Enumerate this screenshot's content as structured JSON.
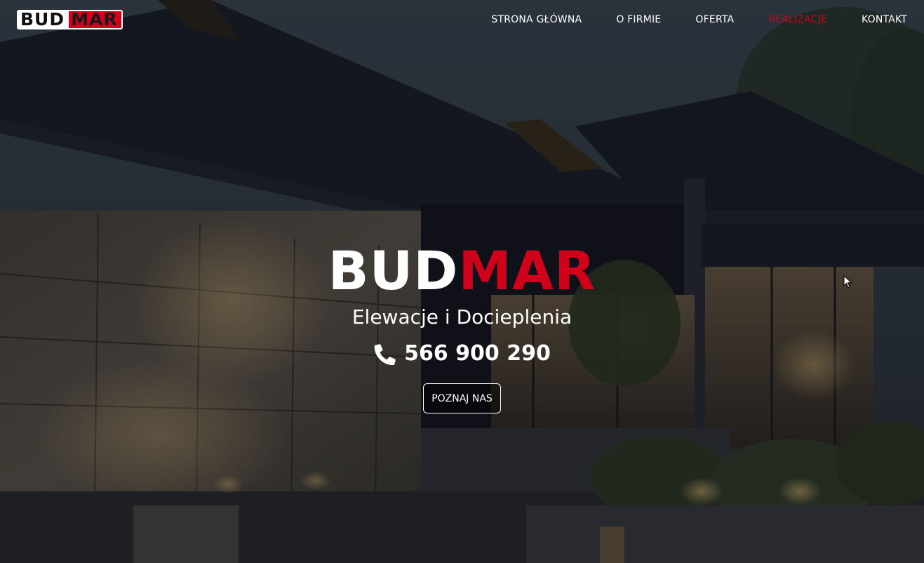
{
  "logo": {
    "part1": "BUD",
    "part2": "MAR"
  },
  "nav": {
    "items": [
      {
        "label": "STRONA GŁÓWNA",
        "active": false
      },
      {
        "label": "O FIRMIE",
        "active": false
      },
      {
        "label": "OFERTA",
        "active": false
      },
      {
        "label": "REALIZACJE",
        "active": true
      },
      {
        "label": "KONTAKT",
        "active": false
      }
    ]
  },
  "hero": {
    "brand_white": "BUD",
    "brand_red": "MAR",
    "subtitle": "Elewacje i Docieplenia",
    "phone": "566 900 290",
    "phone_icon": "phone-icon",
    "cta_label": "POZNAJ NAS"
  },
  "colors": {
    "accent": "#d0021b",
    "text": "#ffffff",
    "background": "#1a1c22"
  }
}
